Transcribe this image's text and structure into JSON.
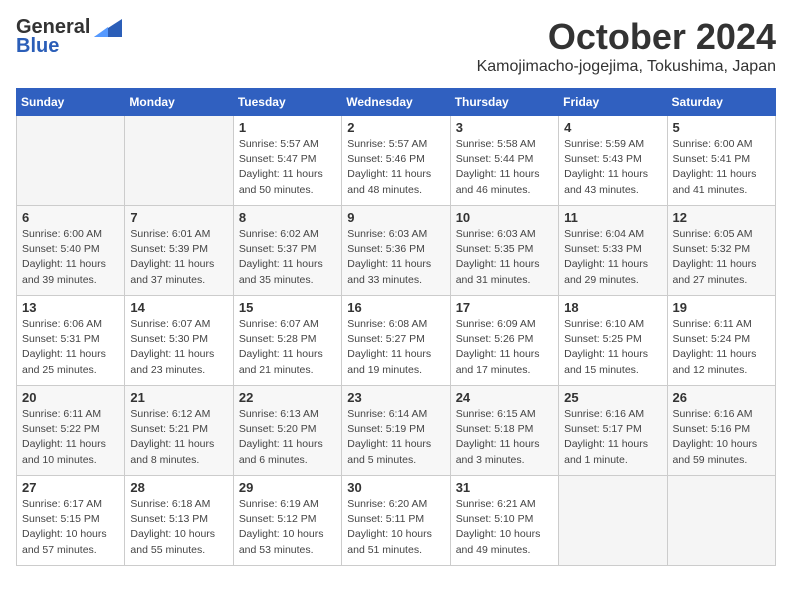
{
  "header": {
    "logo_line1": "General",
    "logo_line2": "Blue",
    "month": "October 2024",
    "location": "Kamojimacho-jogejima, Tokushima, Japan"
  },
  "weekdays": [
    "Sunday",
    "Monday",
    "Tuesday",
    "Wednesday",
    "Thursday",
    "Friday",
    "Saturday"
  ],
  "weeks": [
    [
      {
        "day": "",
        "info": ""
      },
      {
        "day": "",
        "info": ""
      },
      {
        "day": "1",
        "info": "Sunrise: 5:57 AM\nSunset: 5:47 PM\nDaylight: 11 hours\nand 50 minutes."
      },
      {
        "day": "2",
        "info": "Sunrise: 5:57 AM\nSunset: 5:46 PM\nDaylight: 11 hours\nand 48 minutes."
      },
      {
        "day": "3",
        "info": "Sunrise: 5:58 AM\nSunset: 5:44 PM\nDaylight: 11 hours\nand 46 minutes."
      },
      {
        "day": "4",
        "info": "Sunrise: 5:59 AM\nSunset: 5:43 PM\nDaylight: 11 hours\nand 43 minutes."
      },
      {
        "day": "5",
        "info": "Sunrise: 6:00 AM\nSunset: 5:41 PM\nDaylight: 11 hours\nand 41 minutes."
      }
    ],
    [
      {
        "day": "6",
        "info": "Sunrise: 6:00 AM\nSunset: 5:40 PM\nDaylight: 11 hours\nand 39 minutes."
      },
      {
        "day": "7",
        "info": "Sunrise: 6:01 AM\nSunset: 5:39 PM\nDaylight: 11 hours\nand 37 minutes."
      },
      {
        "day": "8",
        "info": "Sunrise: 6:02 AM\nSunset: 5:37 PM\nDaylight: 11 hours\nand 35 minutes."
      },
      {
        "day": "9",
        "info": "Sunrise: 6:03 AM\nSunset: 5:36 PM\nDaylight: 11 hours\nand 33 minutes."
      },
      {
        "day": "10",
        "info": "Sunrise: 6:03 AM\nSunset: 5:35 PM\nDaylight: 11 hours\nand 31 minutes."
      },
      {
        "day": "11",
        "info": "Sunrise: 6:04 AM\nSunset: 5:33 PM\nDaylight: 11 hours\nand 29 minutes."
      },
      {
        "day": "12",
        "info": "Sunrise: 6:05 AM\nSunset: 5:32 PM\nDaylight: 11 hours\nand 27 minutes."
      }
    ],
    [
      {
        "day": "13",
        "info": "Sunrise: 6:06 AM\nSunset: 5:31 PM\nDaylight: 11 hours\nand 25 minutes."
      },
      {
        "day": "14",
        "info": "Sunrise: 6:07 AM\nSunset: 5:30 PM\nDaylight: 11 hours\nand 23 minutes."
      },
      {
        "day": "15",
        "info": "Sunrise: 6:07 AM\nSunset: 5:28 PM\nDaylight: 11 hours\nand 21 minutes."
      },
      {
        "day": "16",
        "info": "Sunrise: 6:08 AM\nSunset: 5:27 PM\nDaylight: 11 hours\nand 19 minutes."
      },
      {
        "day": "17",
        "info": "Sunrise: 6:09 AM\nSunset: 5:26 PM\nDaylight: 11 hours\nand 17 minutes."
      },
      {
        "day": "18",
        "info": "Sunrise: 6:10 AM\nSunset: 5:25 PM\nDaylight: 11 hours\nand 15 minutes."
      },
      {
        "day": "19",
        "info": "Sunrise: 6:11 AM\nSunset: 5:24 PM\nDaylight: 11 hours\nand 12 minutes."
      }
    ],
    [
      {
        "day": "20",
        "info": "Sunrise: 6:11 AM\nSunset: 5:22 PM\nDaylight: 11 hours\nand 10 minutes."
      },
      {
        "day": "21",
        "info": "Sunrise: 6:12 AM\nSunset: 5:21 PM\nDaylight: 11 hours\nand 8 minutes."
      },
      {
        "day": "22",
        "info": "Sunrise: 6:13 AM\nSunset: 5:20 PM\nDaylight: 11 hours\nand 6 minutes."
      },
      {
        "day": "23",
        "info": "Sunrise: 6:14 AM\nSunset: 5:19 PM\nDaylight: 11 hours\nand 5 minutes."
      },
      {
        "day": "24",
        "info": "Sunrise: 6:15 AM\nSunset: 5:18 PM\nDaylight: 11 hours\nand 3 minutes."
      },
      {
        "day": "25",
        "info": "Sunrise: 6:16 AM\nSunset: 5:17 PM\nDaylight: 11 hours\nand 1 minute."
      },
      {
        "day": "26",
        "info": "Sunrise: 6:16 AM\nSunset: 5:16 PM\nDaylight: 10 hours\nand 59 minutes."
      }
    ],
    [
      {
        "day": "27",
        "info": "Sunrise: 6:17 AM\nSunset: 5:15 PM\nDaylight: 10 hours\nand 57 minutes."
      },
      {
        "day": "28",
        "info": "Sunrise: 6:18 AM\nSunset: 5:13 PM\nDaylight: 10 hours\nand 55 minutes."
      },
      {
        "day": "29",
        "info": "Sunrise: 6:19 AM\nSunset: 5:12 PM\nDaylight: 10 hours\nand 53 minutes."
      },
      {
        "day": "30",
        "info": "Sunrise: 6:20 AM\nSunset: 5:11 PM\nDaylight: 10 hours\nand 51 minutes."
      },
      {
        "day": "31",
        "info": "Sunrise: 6:21 AM\nSunset: 5:10 PM\nDaylight: 10 hours\nand 49 minutes."
      },
      {
        "day": "",
        "info": ""
      },
      {
        "day": "",
        "info": ""
      }
    ]
  ]
}
